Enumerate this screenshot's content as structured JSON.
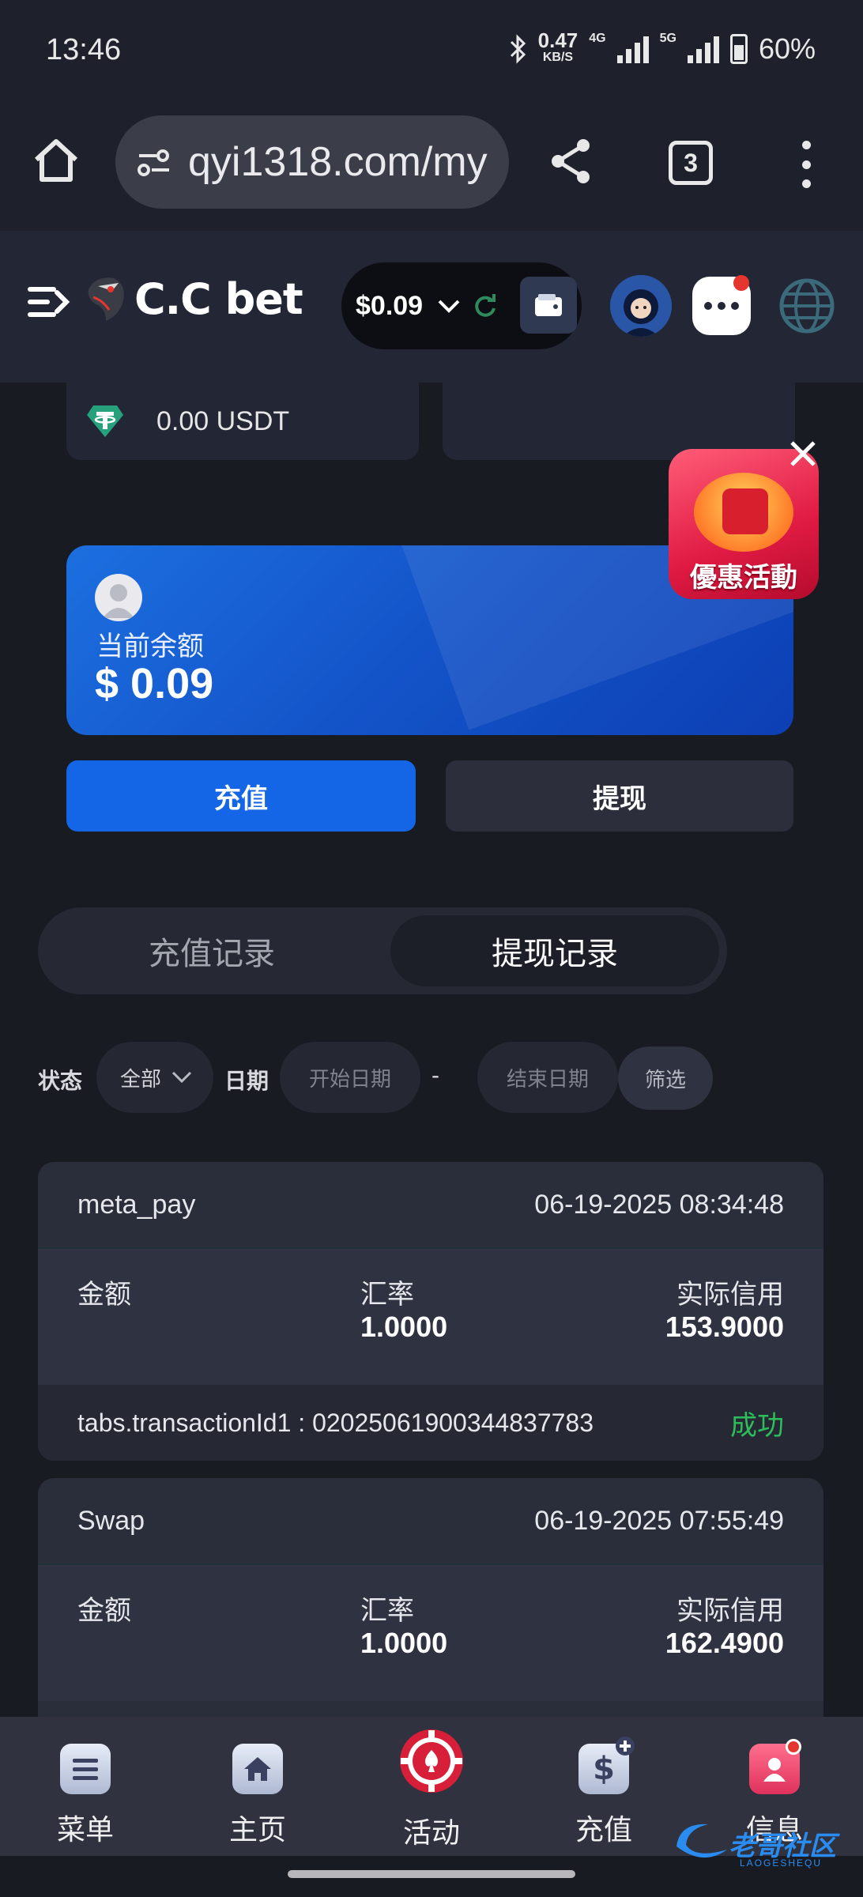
{
  "status_bar": {
    "time": "13:46",
    "net_speed": "0.47",
    "net_speed_unit": "KB/S",
    "net1": "4G",
    "net2": "5G",
    "battery": "60%"
  },
  "browser": {
    "url": "qyi1318.com/my",
    "tab_count": "3",
    "icons": [
      "home-icon",
      "site-settings-icon",
      "share-icon",
      "tabs-icon",
      "more-icon"
    ]
  },
  "header": {
    "logo_text": "C.C bet",
    "balance": "$0.09",
    "icons": [
      "menu-toggle-icon",
      "chevron-down-icon",
      "refresh-icon",
      "wallet-icon",
      "chat-icon",
      "globe-icon"
    ]
  },
  "wallet": {
    "usdt_balance": "0.00 USDT"
  },
  "promo": {
    "label": "優惠活動"
  },
  "balance_card": {
    "label": "当前余额",
    "amount": "$ 0.09"
  },
  "actions": {
    "deposit": "充值",
    "withdraw": "提现"
  },
  "record_tabs": {
    "deposit_records": "充值记录",
    "withdraw_records": "提现记录",
    "active": "提现记录"
  },
  "filters": {
    "status_label": "状态",
    "status_value": "全部",
    "date_label": "日期",
    "start_placeholder": "开始日期",
    "separator": "-",
    "end_placeholder": "结束日期",
    "filter_button": "筛选"
  },
  "records": [
    {
      "method": "meta_pay",
      "time": "06-19-2025 08:34:48",
      "amount_label": "金额",
      "rate_label": "汇率",
      "rate": "1.0000",
      "credit_label": "实际信用",
      "credit": "153.9000",
      "tx_id": "tabs.transactionId1 : 020250619003448377​83",
      "status": "成功"
    },
    {
      "method": "Swap",
      "time": "06-19-2025 07:55:49",
      "amount_label": "金额",
      "rate_label": "汇率",
      "rate": "1.0000",
      "credit_label": "实际信用",
      "credit": "162.4900"
    }
  ],
  "bottom_nav": {
    "menu": "菜单",
    "home": "主页",
    "activity": "活动",
    "deposit": "充值",
    "messages": "信息"
  },
  "watermark": {
    "text": "老哥社区",
    "sub": "LAOGESHEQU"
  },
  "colors": {
    "background": "#191b22",
    "accent_blue": "#1466e6",
    "success_green": "#2dbe5c",
    "badge_red": "#e5352f"
  }
}
